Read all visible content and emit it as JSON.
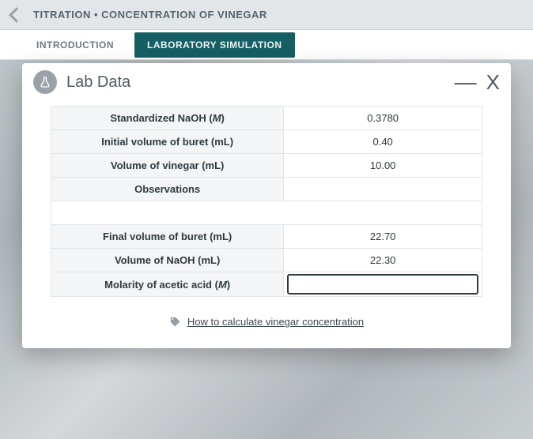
{
  "header": {
    "breadcrumb": "TITRATION • CONCENTRATION OF VINEGAR"
  },
  "tabs": {
    "introduction": "INTRODUCTION",
    "simulation": "LABORATORY SIMULATION"
  },
  "panel": {
    "title": "Lab Data",
    "rows": {
      "naoh_m_label": "Standardized NaOH (M)",
      "naoh_m_value": "0.3780",
      "init_vol_label": "Initial volume of buret (mL)",
      "init_vol_value": "0.40",
      "vinegar_vol_label": "Volume of vinegar (mL)",
      "vinegar_vol_value": "10.00",
      "obs_label": "Observations",
      "obs_value": "",
      "final_vol_label": "Final volume of buret (mL)",
      "final_vol_value": "22.70",
      "naoh_vol_label": "Volume of NaOH (mL)",
      "naoh_vol_value": "22.30",
      "molarity_label": "Molarity of acetic acid (M)",
      "molarity_value": ""
    },
    "help_link": "How to calculate vinegar concentration"
  }
}
